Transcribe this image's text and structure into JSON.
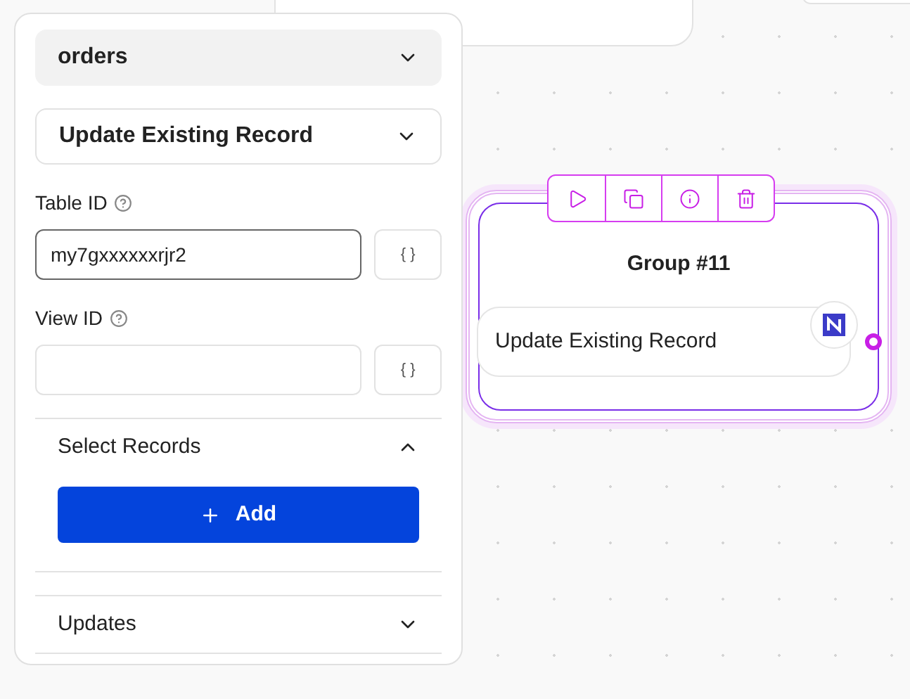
{
  "panel": {
    "base_select": {
      "value": "orders"
    },
    "action_select": {
      "value": "Update Existing Record"
    },
    "fields": [
      {
        "label": "Table ID",
        "value": "my7gxxxxxxrjr2",
        "focused": true,
        "variable_button": "{ }"
      },
      {
        "label": "View ID",
        "focused": false,
        "variable_button": "{ }"
      }
    ],
    "sections": [
      {
        "title": "Select Records",
        "expanded": true,
        "button": "Add"
      },
      {
        "title": "Updates",
        "expanded": false
      }
    ]
  },
  "node": {
    "title": "Group #11",
    "step": "Update Existing Record",
    "selected": true
  }
}
